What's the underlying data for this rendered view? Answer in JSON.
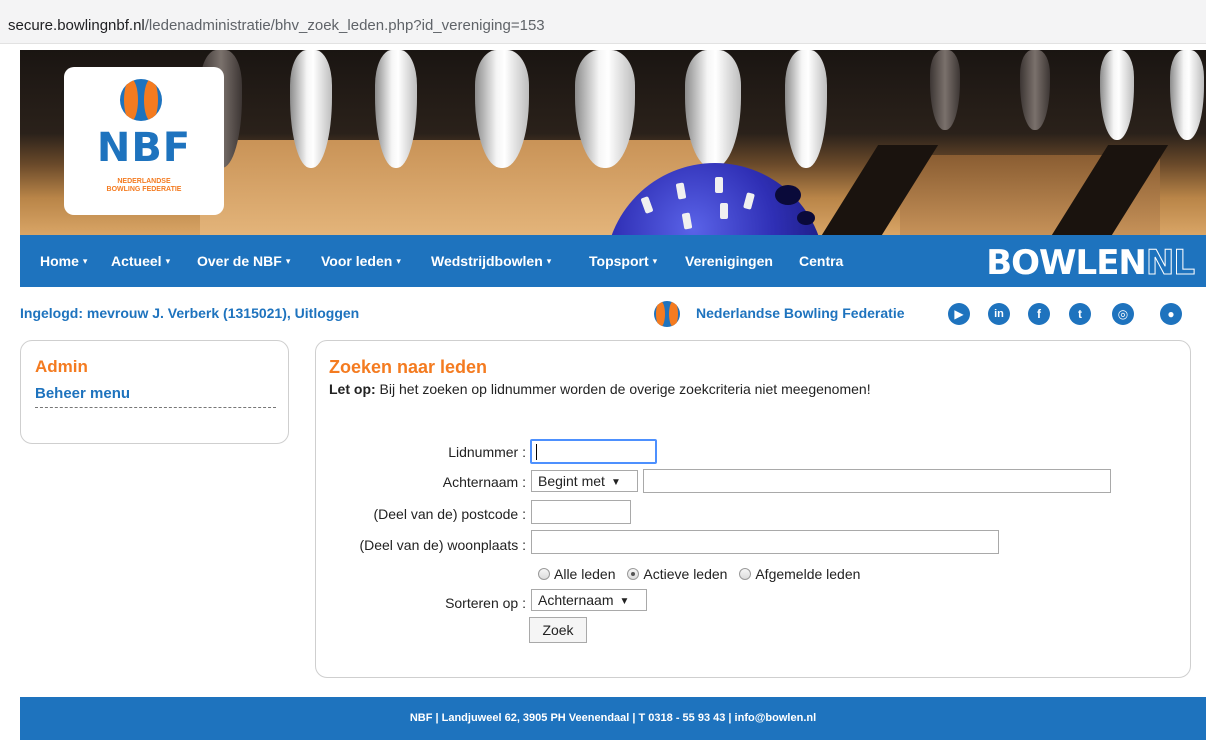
{
  "browser": {
    "url_host": "secure.bowlingnbf.nl",
    "url_path": "/ledenadministratie/bhv_zoek_leden.php?id_vereniging=153"
  },
  "logo": {
    "text": "NBF",
    "subtitle_line1": "NEDERLANDSE",
    "subtitle_line2": "BOWLING FEDERATIE",
    "colors": {
      "blue": "#1e73be",
      "orange": "#f47b20"
    }
  },
  "nav": {
    "items": [
      {
        "label": "Home",
        "has_dropdown": true
      },
      {
        "label": "Actueel",
        "has_dropdown": true
      },
      {
        "label": "Over de NBF",
        "has_dropdown": true
      },
      {
        "label": "Voor leden",
        "has_dropdown": true
      },
      {
        "label": "Wedstrijdbowlen",
        "has_dropdown": true
      },
      {
        "label": "Topsport",
        "has_dropdown": true
      },
      {
        "label": "Verenigingen",
        "has_dropdown": false
      },
      {
        "label": "Centra",
        "has_dropdown": false
      }
    ],
    "brand_main": "BOWLEN",
    "brand_suffix": "NL",
    "caret": "▾"
  },
  "login": {
    "text": "Ingelogd: mevrouw J. Verberk (1315021), Uitloggen",
    "federation_name": "Nederlandse Bowling Federatie",
    "social_icons": [
      "youtube-icon",
      "linkedin-icon",
      "facebook-icon",
      "twitter-icon",
      "instagram-icon",
      "flickr-icon"
    ],
    "social_glyphs": [
      "▶",
      "in",
      "f",
      "t",
      "◎",
      "●"
    ]
  },
  "sidebar": {
    "title": "Admin",
    "link": "Beheer menu"
  },
  "search": {
    "title": "Zoeken naar leden",
    "note_bold": "Let op:",
    "note_text": " Bij het zoeken op lidnummer worden de overige zoekcriteria niet meegenomen!",
    "lidnummer_label": "Lidnummer :",
    "lidnummer_value": "",
    "achternaam_label": "Achternaam :",
    "achternaam_mode": "Begint met",
    "achternaam_value": "",
    "postcode_label": "(Deel van de) postcode :",
    "postcode_value": "",
    "woonplaats_label": "(Deel van de) woonplaats :",
    "woonplaats_value": "",
    "status_options": [
      {
        "label": "Alle leden",
        "checked": false
      },
      {
        "label": "Actieve leden",
        "checked": true
      },
      {
        "label": "Afgemelde leden",
        "checked": false
      }
    ],
    "sort_label": "Sorteren op :",
    "sort_value": "Achternaam",
    "submit_label": "Zoek",
    "select_arrow": "▼"
  },
  "footer": {
    "text": "NBF  |  Landjuweel 62, 3905 PH Veenendaal  |  T 0318 - 55 93 43  |  info@bowlen.nl"
  }
}
